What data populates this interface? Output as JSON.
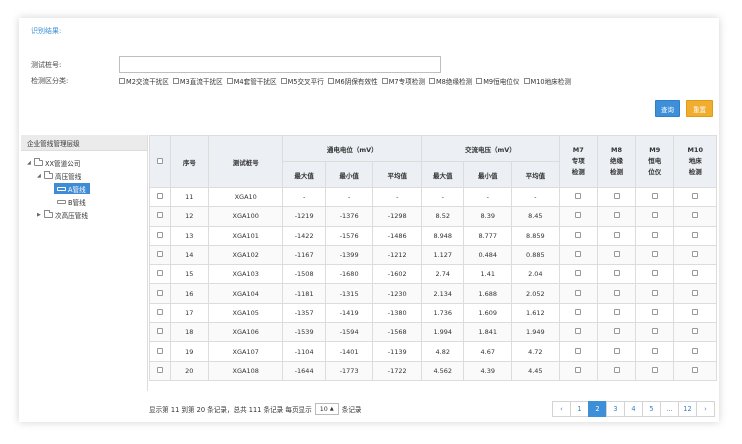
{
  "header": {
    "title": "识别结果:"
  },
  "form": {
    "sn_label": "测试桩号:",
    "sn_value": "",
    "cat_label": "检测区分类:",
    "categories": [
      "M2交流干扰区",
      "M3直流干扰区",
      "M4套管干扰区",
      "M5交叉平行",
      "M6阴保有效性",
      "M7专项检测",
      "M8绝缘检测",
      "M9恒电位仪",
      "M10地床检测"
    ]
  },
  "buttons": {
    "query": "查询",
    "reset": "重置"
  },
  "tree": {
    "title": "企业管线管理层级",
    "nodes": [
      {
        "label": "XX管道公司"
      },
      {
        "label": "高压管线"
      },
      {
        "label": "A管线"
      },
      {
        "label": "B管线"
      },
      {
        "label": "次高压管线"
      }
    ]
  },
  "table": {
    "col_index": "序号",
    "col_sn": "测试桩号",
    "group_dc": "通电电位（mV）",
    "group_ac": "交流电压（mV）",
    "sub_max": "最大值",
    "sub_min": "最小值",
    "sub_avg": "平均值",
    "col_m7": "M7 专项 检测",
    "col_m8": "M8 绝缘 检测",
    "col_m9": "M9 恒电 位仪",
    "col_m10": "M10 地床 检测",
    "rows": [
      [
        "11",
        "XGA10",
        "-",
        "-",
        "-",
        "-",
        "-",
        "-"
      ],
      [
        "12",
        "XGA100",
        "-1219",
        "-1376",
        "-1298",
        "8.52",
        "8.39",
        "8.45"
      ],
      [
        "13",
        "XGA101",
        "-1422",
        "-1576",
        "-1486",
        "8.948",
        "8.777",
        "8.859"
      ],
      [
        "14",
        "XGA102",
        "-1167",
        "-1399",
        "-1212",
        "1.127",
        "0.484",
        "0.885"
      ],
      [
        "15",
        "XGA103",
        "-1508",
        "-1680",
        "-1602",
        "2.74",
        "1.41",
        "2.04"
      ],
      [
        "16",
        "XGA104",
        "-1181",
        "-1315",
        "-1230",
        "2.134",
        "1.688",
        "2.052"
      ],
      [
        "17",
        "XGA105",
        "-1357",
        "-1419",
        "-1380",
        "1.736",
        "1.609",
        "1.612"
      ],
      [
        "18",
        "XGA106",
        "-1539",
        "-1594",
        "-1568",
        "1.994",
        "1.841",
        "1.949"
      ],
      [
        "19",
        "XGA107",
        "-1104",
        "-1401",
        "-1139",
        "4.82",
        "4.67",
        "4.72"
      ],
      [
        "20",
        "XGA108",
        "-1644",
        "-1773",
        "-1722",
        "4.562",
        "4.39",
        "4.45"
      ]
    ]
  },
  "pager": {
    "info_prefix": "显示第 11 到第 20 条记录，总共 111 条记录 每页显示",
    "page_size": "10",
    "info_suffix": "条记录",
    "prev": "‹",
    "pages": [
      "1",
      "2",
      "3",
      "4",
      "5",
      "...",
      "12"
    ],
    "active_page": "2",
    "next": "›"
  }
}
